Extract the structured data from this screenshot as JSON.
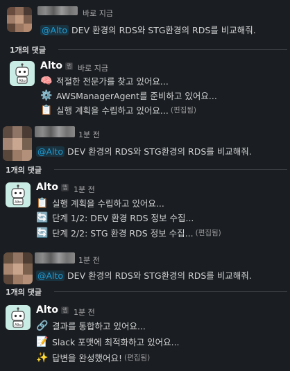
{
  "thread": [
    {
      "user_message": {
        "time": "바로 지금",
        "mention": "@Alto",
        "text": " DEV 환경의 RDS와 STG환경의 RDS를 비교해줘."
      },
      "reply_count": "1개의 댓글",
      "bot_reply": {
        "name": "Alto",
        "app_label": "앱",
        "time": "바로 지금",
        "lines": [
          {
            "icon": "brain-icon",
            "emoji": "🧠",
            "text": "적절한 전문가를 찾고 있어요..."
          },
          {
            "icon": "gear-icon",
            "emoji": "⚙️",
            "text": "AWSManagerAgent를 준비하고 있어요..."
          },
          {
            "icon": "clipboard-icon",
            "emoji": "📋",
            "text": "실행 계획을 수립하고 있어요...",
            "edited": "(편집됨)"
          }
        ]
      }
    },
    {
      "user_message": {
        "time": "1분 전",
        "mention": "@Alto",
        "text": " DEV 환경의 RDS와 STG환경의 RDS를 비교해줘."
      },
      "reply_count": "1개의 댓글",
      "bot_reply": {
        "name": "Alto",
        "app_label": "앱",
        "time": "1분 전",
        "lines": [
          {
            "icon": "clipboard-icon",
            "emoji": "📋",
            "text": "실행 계획을 수립하고 있어요..."
          },
          {
            "icon": "refresh-icon",
            "emoji": "🔄",
            "text": "단계 1/2: DEV 환경 RDS 정보 수집..."
          },
          {
            "icon": "refresh-icon",
            "emoji": "🔄",
            "text": "단계 2/2: STG 환경 RDS 정보 수집...",
            "edited": "(편집됨)"
          }
        ]
      }
    },
    {
      "user_message": {
        "time": "1분 전",
        "mention": "@Alto",
        "text": " DEV 환경의 RDS와 STG환경의 RDS를 비교해줘."
      },
      "reply_count": "1개의 댓글",
      "bot_reply": {
        "name": "Alto",
        "app_label": "앱",
        "time": "1분 전",
        "lines": [
          {
            "icon": "link-icon",
            "emoji": "🔗",
            "text": "결과를 통합하고 있어요..."
          },
          {
            "icon": "memo-icon",
            "emoji": "📝",
            "text": "Slack 포맷에 최적화하고 있어요..."
          },
          {
            "icon": "sparkles-icon",
            "emoji": "✨",
            "text": "답변을 완성했어요!",
            "edited": "(편집됨)"
          }
        ]
      }
    }
  ],
  "colors": {
    "background": "#1a1d21",
    "mention": "#1d9bd1",
    "bot_avatar": "#c9ede4"
  }
}
